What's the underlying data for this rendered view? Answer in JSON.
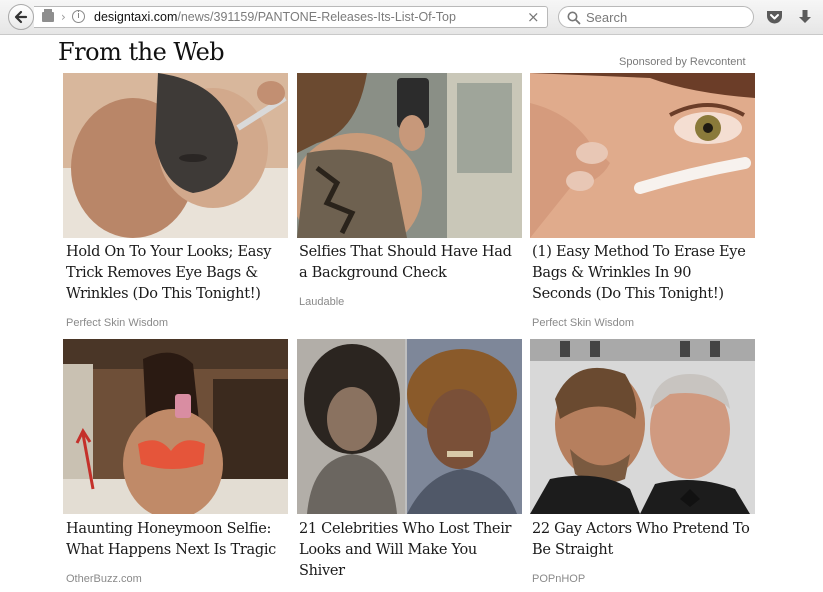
{
  "browser": {
    "url_host": "designtaxi.com",
    "url_path": "/news/391159/PANTONE-Releases-Its-List-Of-Top",
    "search_placeholder": "Search"
  },
  "widget": {
    "heading": "From the Web",
    "sponsor": "Sponsored by Revcontent"
  },
  "tiles": [
    {
      "title": "Hold On To Your Looks; Easy Trick Removes Eye Bags & Wrinkles (Do This Tonight!)",
      "source": "Perfect Skin Wisdom"
    },
    {
      "title": "Selfies That Should Have Had a Background Check",
      "source": "Laudable"
    },
    {
      "title": "(1) Easy Method To Erase Eye Bags & Wrinkles In 90 Seconds (Do This Tonight!)",
      "source": "Perfect Skin Wisdom"
    },
    {
      "title": "Haunting Honeymoon Selfie: What Happens Next Is Tragic",
      "source": "OtherBuzz.com"
    },
    {
      "title": "21 Celebrities Who Lost Their Looks and Will Make You Shiver",
      "source": ""
    },
    {
      "title": "22 Gay Actors Who Pretend To Be Straight",
      "source": "POPnHOP"
    }
  ]
}
